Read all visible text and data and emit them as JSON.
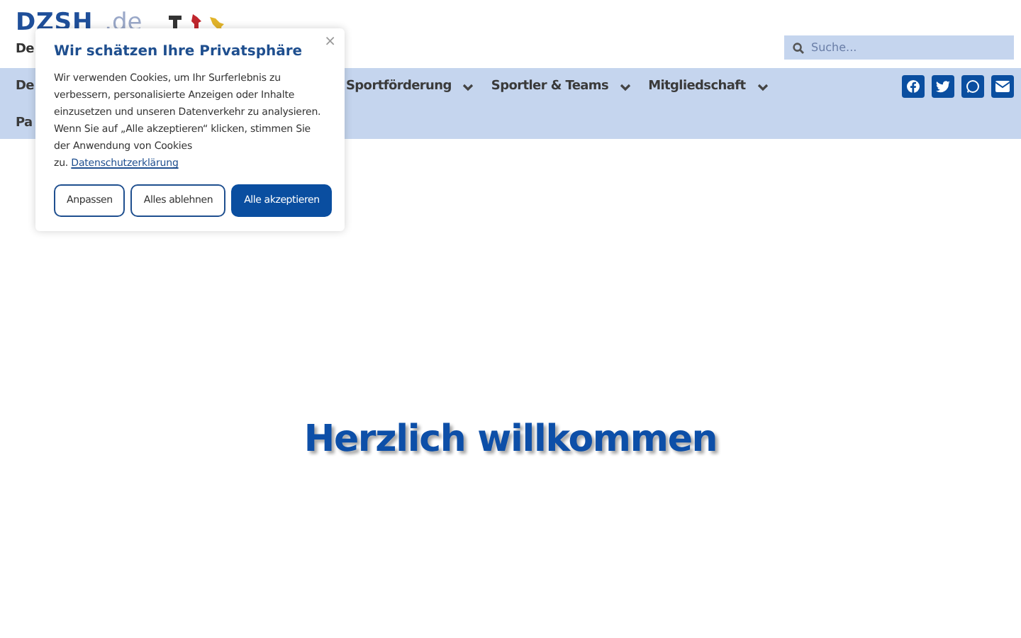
{
  "logo": {
    "name": "DZSH",
    "suffix": ".de",
    "subtitle": "De"
  },
  "search": {
    "placeholder": "Suche..."
  },
  "nav": {
    "items": [
      {
        "label": "De",
        "dropdown": false
      },
      {
        "label": "Sportförderung",
        "dropdown": true
      },
      {
        "label": "Sportler & Teams",
        "dropdown": true
      },
      {
        "label": "Mitgliedschaft",
        "dropdown": true
      }
    ],
    "second_row": [
      {
        "label": "Pa"
      }
    ]
  },
  "social": [
    {
      "kind": "facebook"
    },
    {
      "kind": "twitter"
    },
    {
      "kind": "whatsapp"
    },
    {
      "kind": "email"
    }
  ],
  "heading": "Herzlich willkommen",
  "cookie_dialog": {
    "title": "Wir schätzen Ihre Privatsphäre",
    "close": "×",
    "text": "Wir verwenden Cookies, um Ihr Surferlebnis zu verbessern, personalisierte Anzeigen oder Inhalte einzusetzen und unseren Datenverkehr zu analysieren. Wenn Sie auf „Alle akzeptieren“ klicken, stimmen Sie der Anwendung von Cookies zu.",
    "link": "Datenschutzerklärung",
    "buttons": [
      {
        "label": "Anpassen",
        "primary": false
      },
      {
        "label": "Alles ablehnen",
        "primary": false
      },
      {
        "label": "Alle akzeptieren",
        "primary": true
      }
    ]
  }
}
